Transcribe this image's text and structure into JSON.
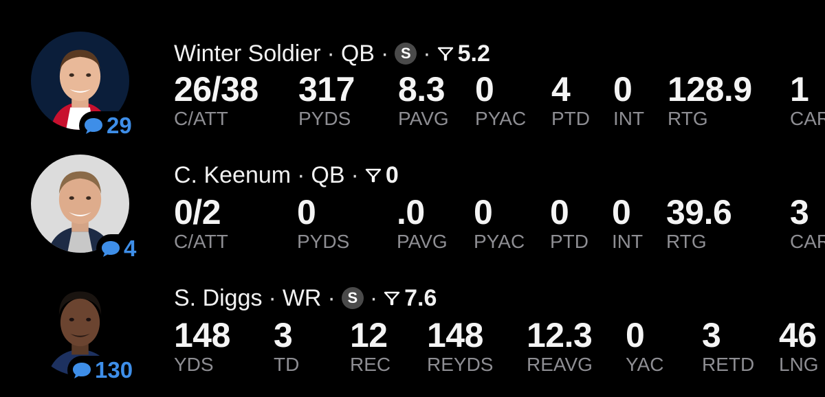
{
  "players": [
    {
      "name": "Winter Soldier",
      "position": "QB",
      "starter_badge": "S",
      "projection": "5.2",
      "comments": "29",
      "stats": [
        {
          "value": "26/38",
          "label": "C/ATT"
        },
        {
          "value": "317",
          "label": "PYDS"
        },
        {
          "value": "8.3",
          "label": "PAVG"
        },
        {
          "value": "0",
          "label": "PYAC"
        },
        {
          "value": "4",
          "label": "PTD"
        },
        {
          "value": "0",
          "label": "INT"
        },
        {
          "value": "128.9",
          "label": "RTG"
        },
        {
          "value": "1",
          "label": "CAR"
        }
      ]
    },
    {
      "name": "C. Keenum",
      "position": "QB",
      "projection": "0",
      "comments": "4",
      "stats": [
        {
          "value": "0/2",
          "label": "C/ATT"
        },
        {
          "value": "0",
          "label": "PYDS"
        },
        {
          "value": ".0",
          "label": "PAVG"
        },
        {
          "value": "0",
          "label": "PYAC"
        },
        {
          "value": "0",
          "label": "PTD"
        },
        {
          "value": "0",
          "label": "INT"
        },
        {
          "value": "39.6",
          "label": "RTG"
        },
        {
          "value": "3",
          "label": "CAR"
        }
      ]
    },
    {
      "name": "S. Diggs",
      "position": "WR",
      "starter_badge": "S",
      "projection": "7.6",
      "comments": "130",
      "stats": [
        {
          "value": "148",
          "label": "YDS"
        },
        {
          "value": "3",
          "label": "TD"
        },
        {
          "value": "12",
          "label": "REC"
        },
        {
          "value": "148",
          "label": "REYDS"
        },
        {
          "value": "12.3",
          "label": "REAVG"
        },
        {
          "value": "0",
          "label": "YAC"
        },
        {
          "value": "3",
          "label": "RETD"
        },
        {
          "value": "46",
          "label": "LNG"
        }
      ]
    }
  ],
  "icons": {
    "comment": "speech-bubble-icon",
    "projection": "funnel-projection-icon",
    "avatar": "player-headshot"
  },
  "colors": {
    "background": "#000000",
    "accent": "#3e8ee8",
    "label": "#8e8e93",
    "badge": "#4a4a4a"
  }
}
